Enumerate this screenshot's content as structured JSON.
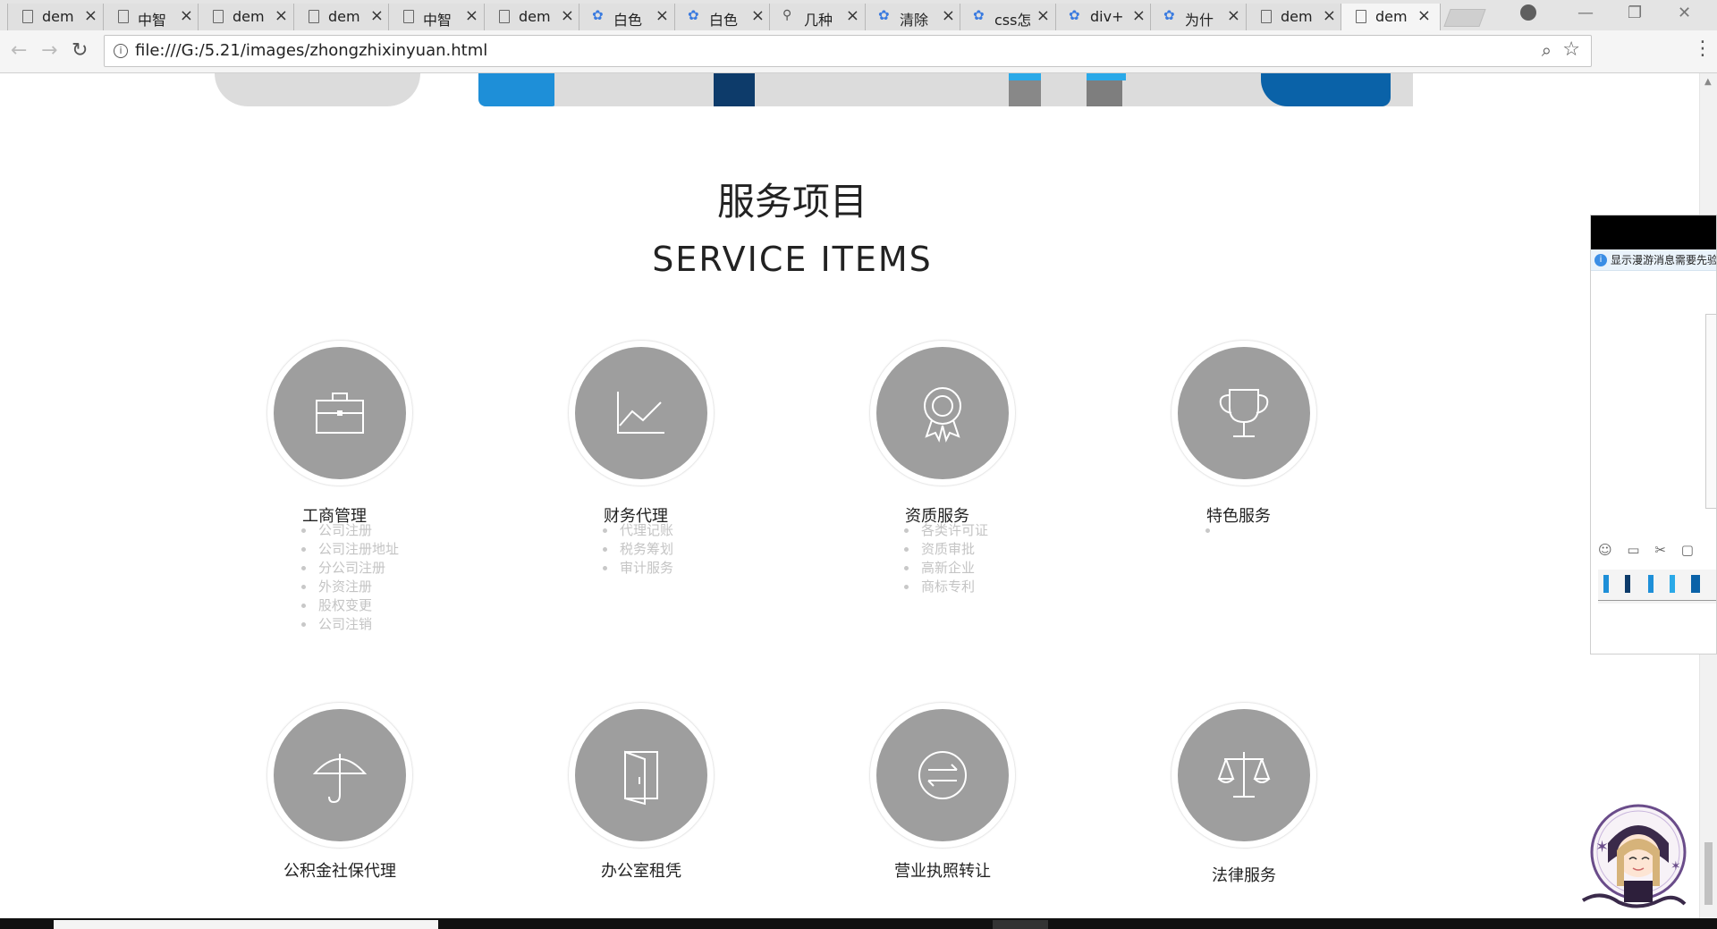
{
  "tabs": [
    {
      "label": "dem",
      "icon": "doc"
    },
    {
      "label": "中智",
      "icon": "doc"
    },
    {
      "label": "dem",
      "icon": "doc"
    },
    {
      "label": "dem",
      "icon": "doc"
    },
    {
      "label": "中智",
      "icon": "doc"
    },
    {
      "label": "dem",
      "icon": "doc"
    },
    {
      "label": "白色",
      "icon": "paw"
    },
    {
      "label": "白色",
      "icon": "paw"
    },
    {
      "label": "几种",
      "icon": "search"
    },
    {
      "label": "清除",
      "icon": "paw"
    },
    {
      "label": "css怎",
      "icon": "paw"
    },
    {
      "label": "div+",
      "icon": "paw"
    },
    {
      "label": "为什",
      "icon": "paw"
    },
    {
      "label": "dem",
      "icon": "doc"
    },
    {
      "label": "dem",
      "icon": "doc",
      "active": true
    }
  ],
  "address_bar": {
    "url": "file:///G:/5.21/images/zhongzhixinyuan.html"
  },
  "section": {
    "title_cn": "服务项目",
    "title_en": "SERVICE ITEMS"
  },
  "services": [
    {
      "title": "工商管理",
      "icon": "briefcase-icon",
      "items": [
        "公司注册",
        "公司注册地址",
        "分公司注册",
        "外资注册",
        "股权变更",
        "公司注销"
      ]
    },
    {
      "title": "财务代理",
      "icon": "line-chart-icon",
      "items": [
        "代理记账",
        "税务筹划",
        "审计服务"
      ]
    },
    {
      "title": "资质服务",
      "icon": "award-badge-icon",
      "items": [
        "各类许可证",
        "资质审批",
        "高新企业",
        "商标专利"
      ]
    },
    {
      "title": "特色服务",
      "icon": "trophy-icon",
      "items": [
        ""
      ]
    },
    {
      "title": "公积金社保代理",
      "icon": "umbrella-icon",
      "items": []
    },
    {
      "title": "办公室租凭",
      "icon": "door-icon",
      "items": []
    },
    {
      "title": "营业执照转让",
      "icon": "transfer-arrows-icon",
      "items": []
    },
    {
      "title": "法律服务",
      "icon": "scales-icon",
      "items": []
    }
  ],
  "chat_popup": {
    "notice": "显示漫游消息需要先验"
  },
  "colors": {
    "icon_circle": "#9e9e9e",
    "list_text": "#c4c4c4",
    "notice_blue": "#3b8ee5"
  }
}
